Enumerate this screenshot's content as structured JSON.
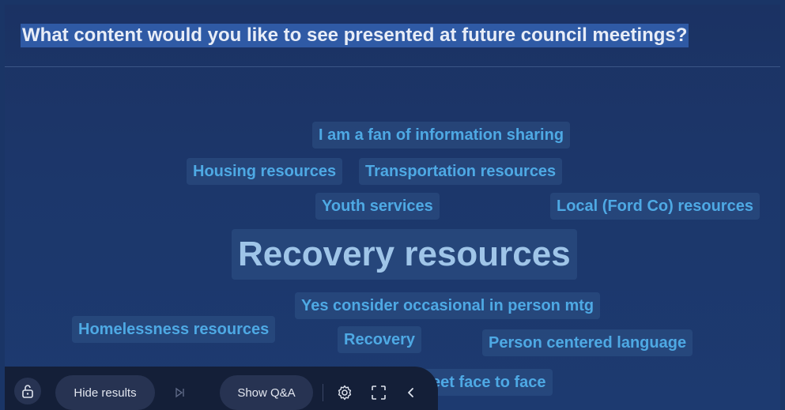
{
  "question": "What content would you like to see presented at future council meetings?",
  "words": [
    {
      "text": "I am a fan of information sharing"
    },
    {
      "text": "Housing resources"
    },
    {
      "text": "Transportation resources"
    },
    {
      "text": "Youth services"
    },
    {
      "text": "Local (Ford Co) resources"
    },
    {
      "text": "Recovery resources"
    },
    {
      "text": "Yes consider occasional in person mtg"
    },
    {
      "text": "Homelessness resources"
    },
    {
      "text": "Recovery"
    },
    {
      "text": "Person centered language"
    },
    {
      "text": "eet face to face"
    }
  ],
  "toolbar": {
    "lock_icon": "unlock-icon",
    "hide_results_label": "Hide results",
    "next_icon": "skip-next-icon",
    "show_qa_label": "Show Q&A",
    "settings_icon": "gear-icon",
    "fullscreen_icon": "fullscreen-icon",
    "collapse_icon": "chevron-left-icon"
  },
  "colors": {
    "background": "#1c376b",
    "word_text": "#4ea9e4",
    "highlight": "#2f5aa5",
    "toolbar": "#141f38"
  }
}
